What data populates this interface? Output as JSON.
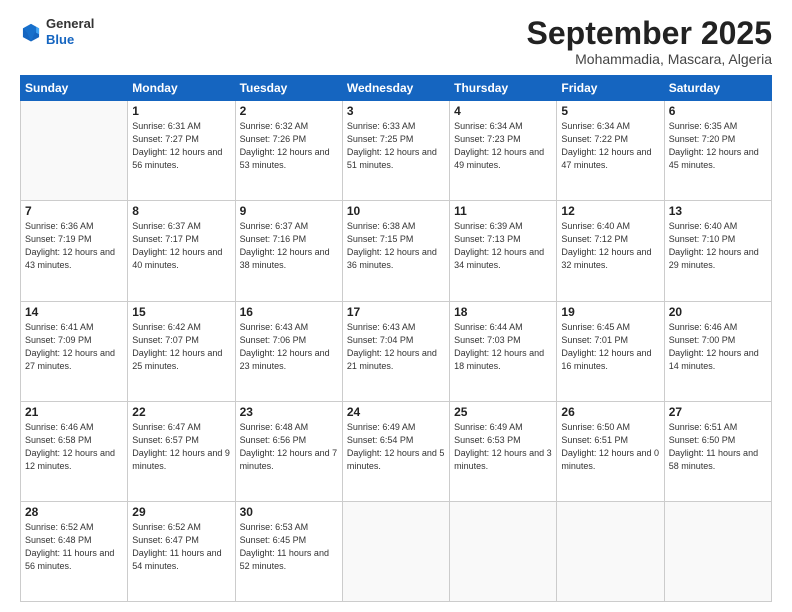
{
  "logo": {
    "line1": "General",
    "line2": "Blue"
  },
  "header": {
    "month": "September 2025",
    "location": "Mohammadia, Mascara, Algeria"
  },
  "weekdays": [
    "Sunday",
    "Monday",
    "Tuesday",
    "Wednesday",
    "Thursday",
    "Friday",
    "Saturday"
  ],
  "weeks": [
    [
      {
        "day": "",
        "sunrise": "",
        "sunset": "",
        "daylight": ""
      },
      {
        "day": "1",
        "sunrise": "Sunrise: 6:31 AM",
        "sunset": "Sunset: 7:27 PM",
        "daylight": "Daylight: 12 hours and 56 minutes."
      },
      {
        "day": "2",
        "sunrise": "Sunrise: 6:32 AM",
        "sunset": "Sunset: 7:26 PM",
        "daylight": "Daylight: 12 hours and 53 minutes."
      },
      {
        "day": "3",
        "sunrise": "Sunrise: 6:33 AM",
        "sunset": "Sunset: 7:25 PM",
        "daylight": "Daylight: 12 hours and 51 minutes."
      },
      {
        "day": "4",
        "sunrise": "Sunrise: 6:34 AM",
        "sunset": "Sunset: 7:23 PM",
        "daylight": "Daylight: 12 hours and 49 minutes."
      },
      {
        "day": "5",
        "sunrise": "Sunrise: 6:34 AM",
        "sunset": "Sunset: 7:22 PM",
        "daylight": "Daylight: 12 hours and 47 minutes."
      },
      {
        "day": "6",
        "sunrise": "Sunrise: 6:35 AM",
        "sunset": "Sunset: 7:20 PM",
        "daylight": "Daylight: 12 hours and 45 minutes."
      }
    ],
    [
      {
        "day": "7",
        "sunrise": "Sunrise: 6:36 AM",
        "sunset": "Sunset: 7:19 PM",
        "daylight": "Daylight: 12 hours and 43 minutes."
      },
      {
        "day": "8",
        "sunrise": "Sunrise: 6:37 AM",
        "sunset": "Sunset: 7:17 PM",
        "daylight": "Daylight: 12 hours and 40 minutes."
      },
      {
        "day": "9",
        "sunrise": "Sunrise: 6:37 AM",
        "sunset": "Sunset: 7:16 PM",
        "daylight": "Daylight: 12 hours and 38 minutes."
      },
      {
        "day": "10",
        "sunrise": "Sunrise: 6:38 AM",
        "sunset": "Sunset: 7:15 PM",
        "daylight": "Daylight: 12 hours and 36 minutes."
      },
      {
        "day": "11",
        "sunrise": "Sunrise: 6:39 AM",
        "sunset": "Sunset: 7:13 PM",
        "daylight": "Daylight: 12 hours and 34 minutes."
      },
      {
        "day": "12",
        "sunrise": "Sunrise: 6:40 AM",
        "sunset": "Sunset: 7:12 PM",
        "daylight": "Daylight: 12 hours and 32 minutes."
      },
      {
        "day": "13",
        "sunrise": "Sunrise: 6:40 AM",
        "sunset": "Sunset: 7:10 PM",
        "daylight": "Daylight: 12 hours and 29 minutes."
      }
    ],
    [
      {
        "day": "14",
        "sunrise": "Sunrise: 6:41 AM",
        "sunset": "Sunset: 7:09 PM",
        "daylight": "Daylight: 12 hours and 27 minutes."
      },
      {
        "day": "15",
        "sunrise": "Sunrise: 6:42 AM",
        "sunset": "Sunset: 7:07 PM",
        "daylight": "Daylight: 12 hours and 25 minutes."
      },
      {
        "day": "16",
        "sunrise": "Sunrise: 6:43 AM",
        "sunset": "Sunset: 7:06 PM",
        "daylight": "Daylight: 12 hours and 23 minutes."
      },
      {
        "day": "17",
        "sunrise": "Sunrise: 6:43 AM",
        "sunset": "Sunset: 7:04 PM",
        "daylight": "Daylight: 12 hours and 21 minutes."
      },
      {
        "day": "18",
        "sunrise": "Sunrise: 6:44 AM",
        "sunset": "Sunset: 7:03 PM",
        "daylight": "Daylight: 12 hours and 18 minutes."
      },
      {
        "day": "19",
        "sunrise": "Sunrise: 6:45 AM",
        "sunset": "Sunset: 7:01 PM",
        "daylight": "Daylight: 12 hours and 16 minutes."
      },
      {
        "day": "20",
        "sunrise": "Sunrise: 6:46 AM",
        "sunset": "Sunset: 7:00 PM",
        "daylight": "Daylight: 12 hours and 14 minutes."
      }
    ],
    [
      {
        "day": "21",
        "sunrise": "Sunrise: 6:46 AM",
        "sunset": "Sunset: 6:58 PM",
        "daylight": "Daylight: 12 hours and 12 minutes."
      },
      {
        "day": "22",
        "sunrise": "Sunrise: 6:47 AM",
        "sunset": "Sunset: 6:57 PM",
        "daylight": "Daylight: 12 hours and 9 minutes."
      },
      {
        "day": "23",
        "sunrise": "Sunrise: 6:48 AM",
        "sunset": "Sunset: 6:56 PM",
        "daylight": "Daylight: 12 hours and 7 minutes."
      },
      {
        "day": "24",
        "sunrise": "Sunrise: 6:49 AM",
        "sunset": "Sunset: 6:54 PM",
        "daylight": "Daylight: 12 hours and 5 minutes."
      },
      {
        "day": "25",
        "sunrise": "Sunrise: 6:49 AM",
        "sunset": "Sunset: 6:53 PM",
        "daylight": "Daylight: 12 hours and 3 minutes."
      },
      {
        "day": "26",
        "sunrise": "Sunrise: 6:50 AM",
        "sunset": "Sunset: 6:51 PM",
        "daylight": "Daylight: 12 hours and 0 minutes."
      },
      {
        "day": "27",
        "sunrise": "Sunrise: 6:51 AM",
        "sunset": "Sunset: 6:50 PM",
        "daylight": "Daylight: 11 hours and 58 minutes."
      }
    ],
    [
      {
        "day": "28",
        "sunrise": "Sunrise: 6:52 AM",
        "sunset": "Sunset: 6:48 PM",
        "daylight": "Daylight: 11 hours and 56 minutes."
      },
      {
        "day": "29",
        "sunrise": "Sunrise: 6:52 AM",
        "sunset": "Sunset: 6:47 PM",
        "daylight": "Daylight: 11 hours and 54 minutes."
      },
      {
        "day": "30",
        "sunrise": "Sunrise: 6:53 AM",
        "sunset": "Sunset: 6:45 PM",
        "daylight": "Daylight: 11 hours and 52 minutes."
      },
      {
        "day": "",
        "sunrise": "",
        "sunset": "",
        "daylight": ""
      },
      {
        "day": "",
        "sunrise": "",
        "sunset": "",
        "daylight": ""
      },
      {
        "day": "",
        "sunrise": "",
        "sunset": "",
        "daylight": ""
      },
      {
        "day": "",
        "sunrise": "",
        "sunset": "",
        "daylight": ""
      }
    ]
  ]
}
